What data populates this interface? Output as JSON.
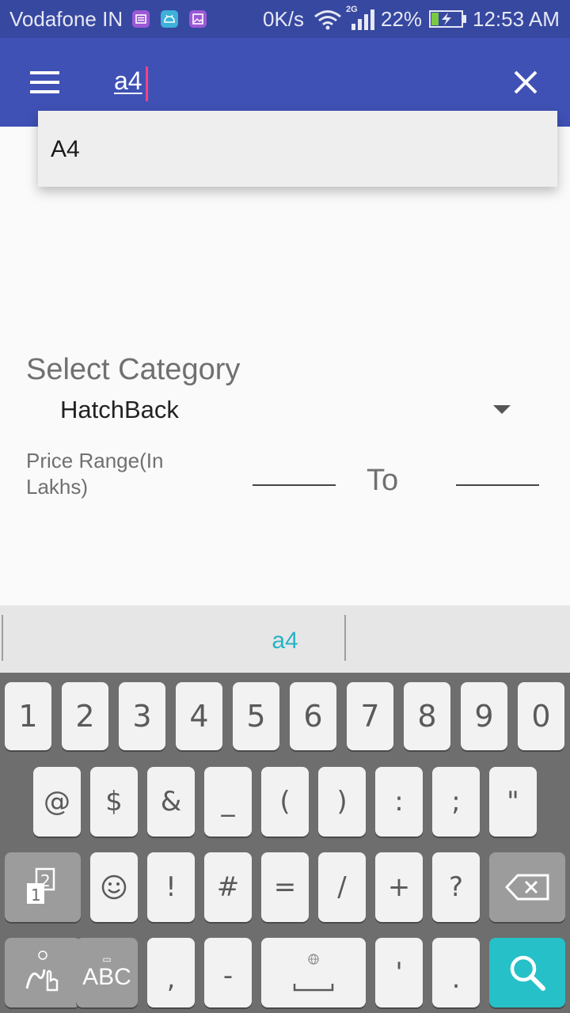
{
  "status_bar": {
    "carrier": "Vodafone IN",
    "net_speed": "0K/s",
    "network_type": "2G",
    "battery_percent": "22%",
    "time": "12:53 AM",
    "notification_icons": [
      "notification-message-icon",
      "android-icon",
      "image-icon"
    ]
  },
  "toolbar": {
    "search_query": "a4",
    "menu_icon": "hamburger-menu-icon",
    "close_icon": "close-icon"
  },
  "suggestions": [
    {
      "label": "A4"
    }
  ],
  "form": {
    "category_label": "Select Category",
    "category_value": "HatchBack",
    "price_range_label": "Price Range(In Lakhs)",
    "to_label": "To",
    "price_min_value": "",
    "price_max_value": ""
  },
  "keyboard": {
    "suggestion": "a4",
    "row1": [
      "1",
      "2",
      "3",
      "4",
      "5",
      "6",
      "7",
      "8",
      "9",
      "0"
    ],
    "row2": [
      "@",
      "$",
      "&",
      "_",
      "(",
      ")",
      ":",
      ";",
      "\""
    ],
    "row3": [
      "!",
      "#",
      "=",
      "/",
      "+",
      "?"
    ],
    "abc_label": "ABC",
    "comma": ",",
    "dash": "-",
    "apostrophe": "'",
    "period": "."
  },
  "colors": {
    "toolbar": "#3f51b5",
    "status_bar": "#3748a0",
    "cursor": "#ff4081",
    "keyboard_accent": "#26c0c8"
  }
}
